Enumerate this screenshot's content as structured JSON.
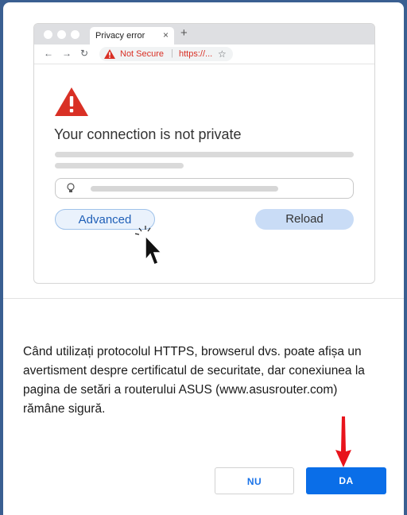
{
  "illustration": {
    "tab_title": "Privacy error",
    "tab_close": "×",
    "new_tab": "+",
    "nav_back": "←",
    "nav_forward": "→",
    "nav_reload": "↻",
    "security_label": "Not Secure",
    "separator": "|",
    "url": "https://...",
    "star": "☆",
    "headline": "Your connection is not private",
    "advanced_label": "Advanced",
    "reload_label": "Reload"
  },
  "dialog": {
    "message": "Când utilizați protocolul HTTPS, browserul dvs. poate afișa un avertisment despre certificatul de securitate, dar conexiunea la pagina de setări a routerului ASUS (www.asusrouter.com) rămâne sigură.",
    "no_label": "NU",
    "yes_label": "DA"
  },
  "colors": {
    "warning_red": "#d93025",
    "primary_blue": "#0a6ee8",
    "annotation_arrow": "#e8141c"
  },
  "icons": [
    "warning-triangle-icon",
    "lightbulb-icon",
    "mouse-pointer-icon",
    "red-arrow-icon",
    "star-icon"
  ]
}
